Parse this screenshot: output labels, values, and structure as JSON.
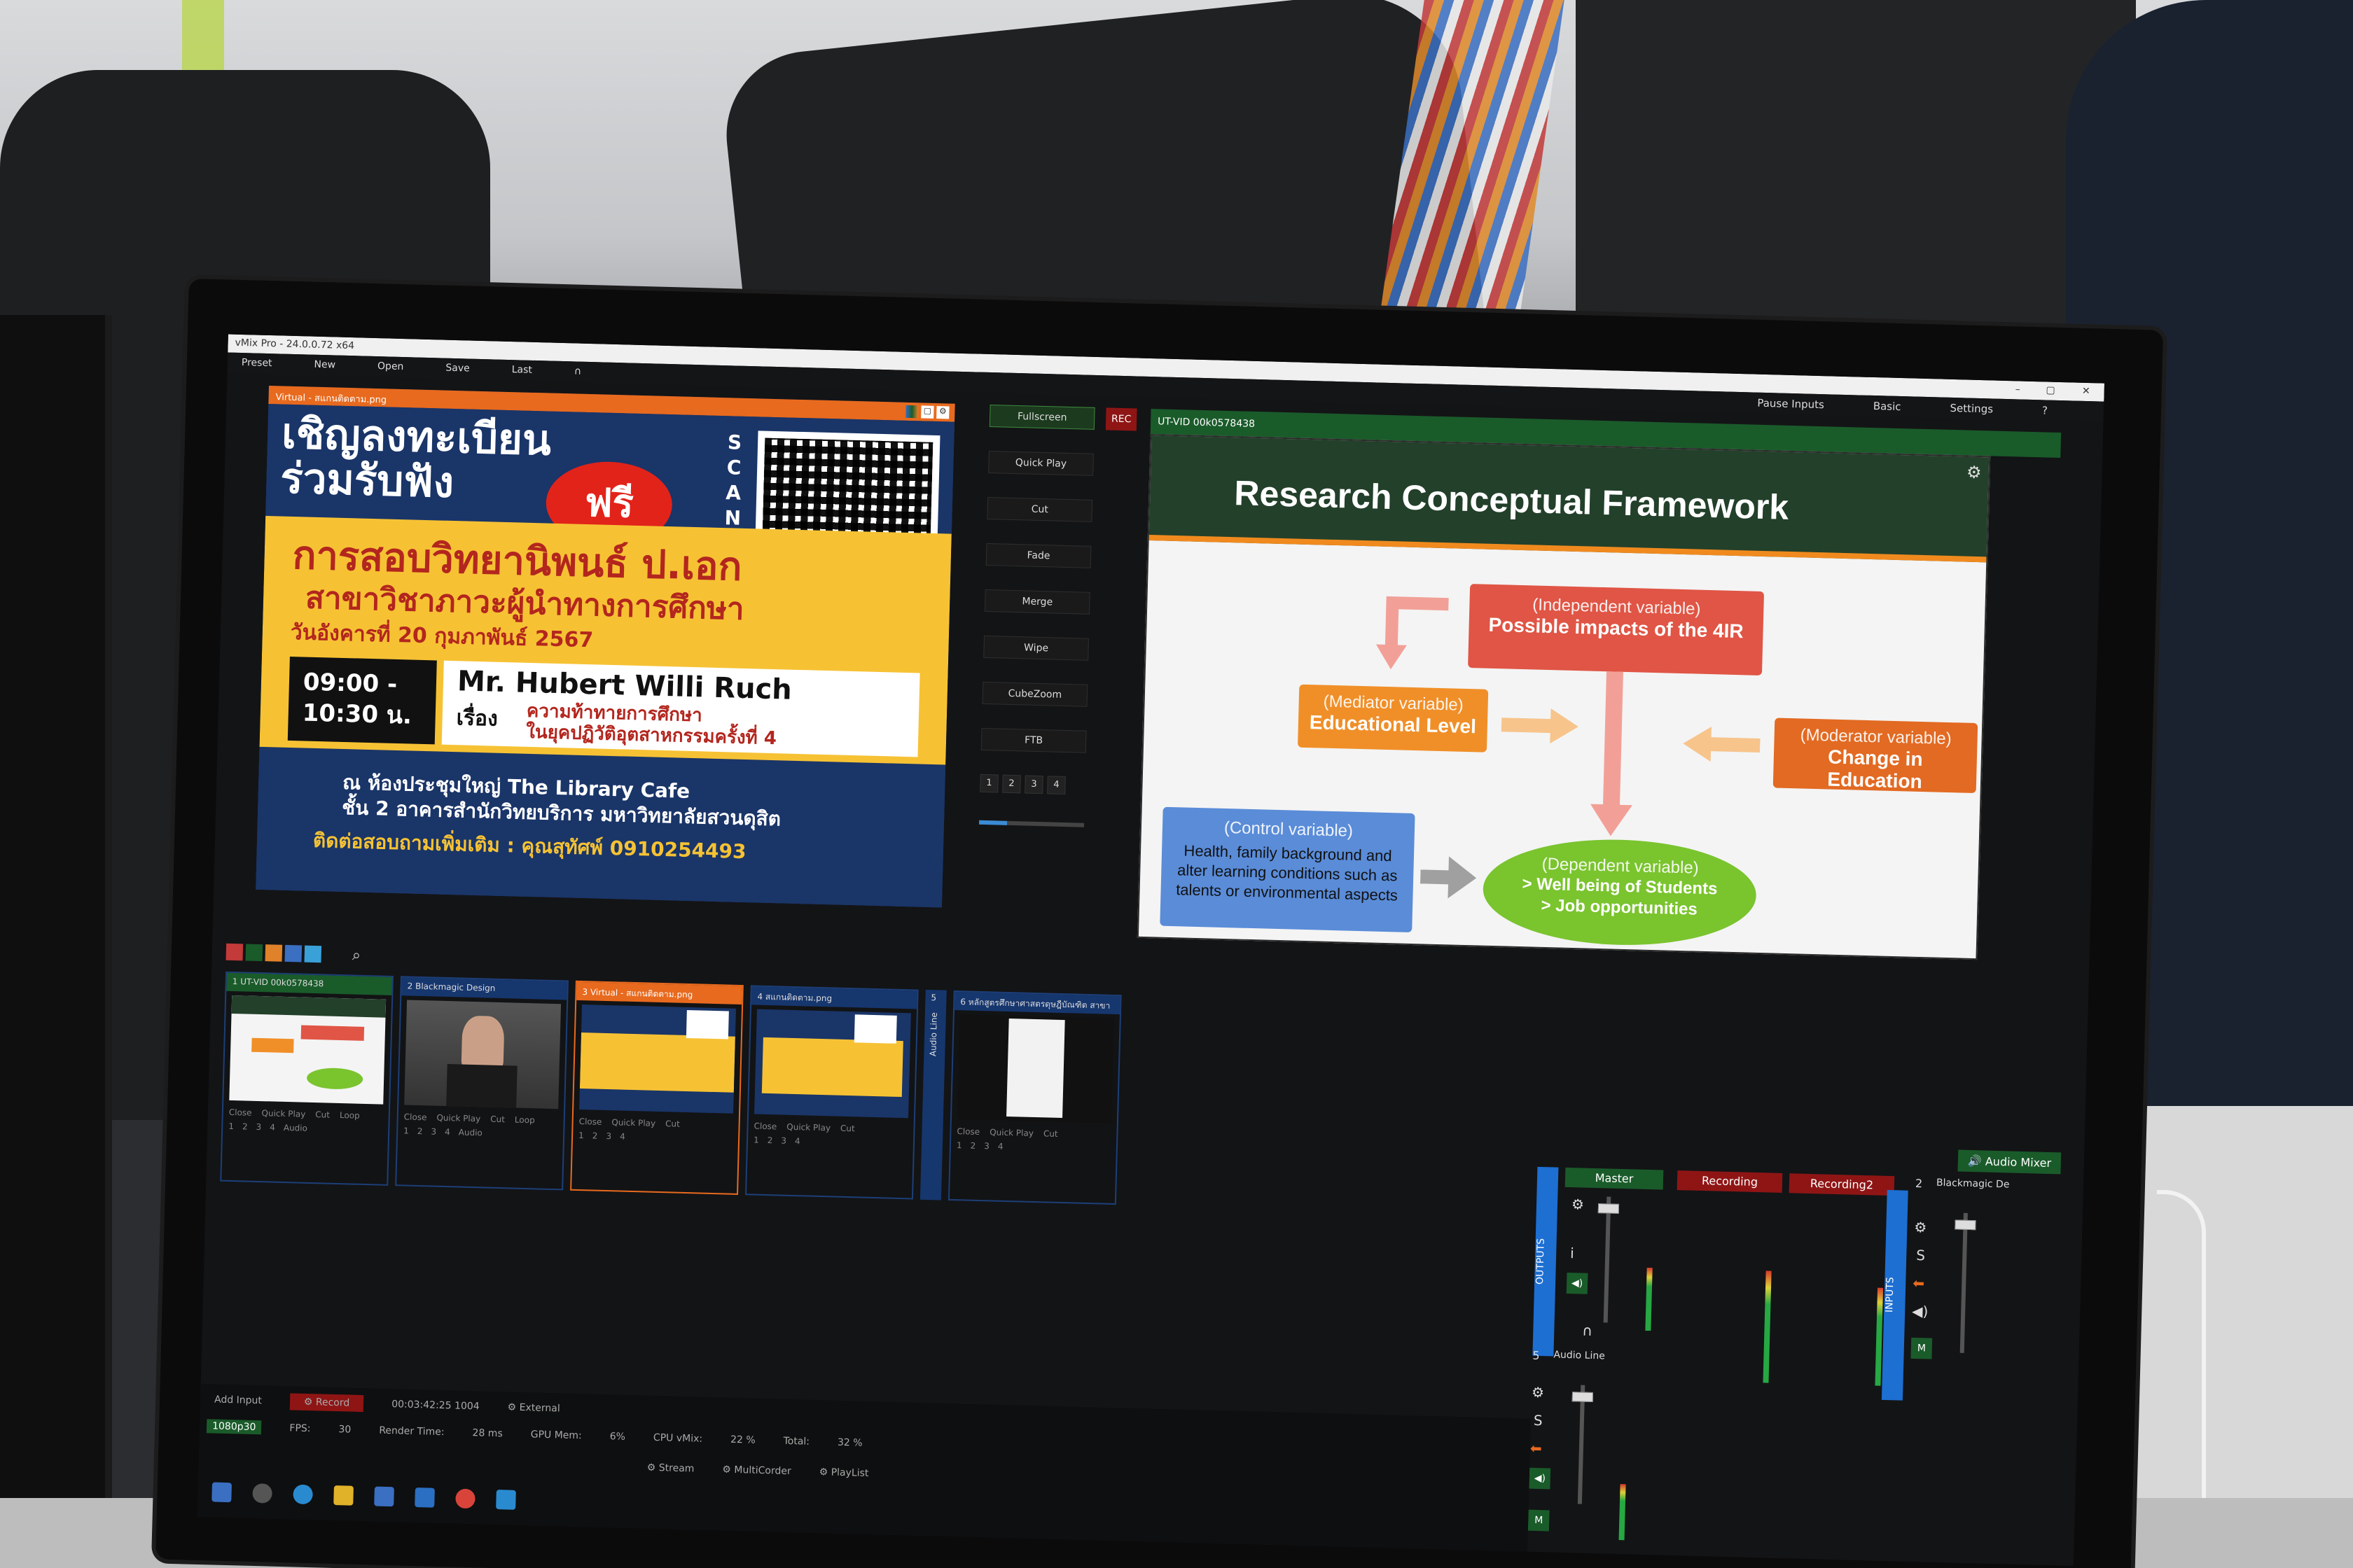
{
  "window": {
    "title": "vMix Pro - 24.0.0.72 x64",
    "menu": [
      "Preset",
      "New",
      "Open",
      "Save",
      "Last"
    ]
  },
  "preview": {
    "header": "Virtual - สแกนติดตาม.png",
    "poster": {
      "line1": "เชิญลงทะเบียน",
      "line2": "ร่วมรับฟัง",
      "free": "ฟรี",
      "scan": [
        "S",
        "C",
        "A",
        "N"
      ],
      "headline": "การสอบวิทยานิพนธ์ ป.เอก",
      "program": "สาขาวิชาภาวะผู้นำทางการศึกษา",
      "date": "วันอังคารที่ 20 กุมภาพันธ์ 2567",
      "time_start": "09:00 -",
      "time_end": "10:30 น.",
      "speaker": "Mr. Hubert Willi Ruch",
      "topic_label": "เรื่อง",
      "topic_line1": "ความท้าทายการศึกษา",
      "topic_line2": "ในยุคปฏิวัติอุตสาหกรรมครั้งที่ 4",
      "venue_line1": "ณ ห้องประชุมใหญ่ The Library Cafe",
      "venue_line2": "ชั้น 2 อาคารสำนักวิทยบริการ มหาวิทยาลัยสวนดุสิต",
      "contact": "ติดต่อสอบถามเพิ่มเติม : คุณสุทัศพ์  0910254493"
    }
  },
  "transitions": {
    "top": "Fullscreen",
    "rec": "REC",
    "buttons": [
      "Quick Play",
      "Cut",
      "Fade",
      "Merge",
      "Wipe",
      "CubeZoom",
      "FTB"
    ],
    "numbers": [
      "1",
      "2",
      "3",
      "4"
    ]
  },
  "output": {
    "header": "UT-VID 00k0578438",
    "menu": [
      "Pause Inputs",
      "Basic",
      "Settings",
      "?"
    ],
    "slide": {
      "title": "Research Conceptual Framework",
      "independent_label": "(Independent variable)",
      "independent_text": "Possible impacts of the 4IR",
      "mediator_label": "(Mediator variable)",
      "mediator_text": "Educational Level",
      "moderator_label": "(Moderator variable)",
      "moderator_text": "Change in Education",
      "control_label": "(Control variable)",
      "control_text": "Health, family background and alter learning conditions such as talents or environmental aspects",
      "dependent_label": "(Dependent variable)",
      "dependent_line1": "> Well being of Students",
      "dependent_line2": "> Job opportunities"
    }
  },
  "inputs": {
    "palette": [
      "#c23a3a",
      "#1a5b2a",
      "#e0822a",
      "#3a6fc2",
      "#3aa0d8"
    ],
    "tiles": [
      {
        "head": "1 UT-VID 00k0578438",
        "style": "green",
        "ctrls": [
          "Close",
          "Quick Play",
          "Cut",
          "Loop"
        ],
        "nums": [
          "1",
          "2",
          "3",
          "4"
        ],
        "extra": "Audio"
      },
      {
        "head": "2 Blackmagic Design",
        "style": "blue",
        "ctrls": [
          "Close",
          "Quick Play",
          "Cut",
          "Loop"
        ],
        "nums": [
          "1",
          "2",
          "3",
          "4"
        ],
        "extra": "Audio"
      },
      {
        "head": "3 Virtual - สแกนติดตาม.png",
        "style": "orange",
        "ctrls": [
          "Close",
          "Quick Play",
          "Cut"
        ],
        "nums": [
          "1",
          "2",
          "3",
          "4"
        ],
        "extra": ""
      },
      {
        "head": "4 สแกนติดตาม.png",
        "style": "blue",
        "ctrls": [
          "Close",
          "Quick Play",
          "Cut"
        ],
        "nums": [
          "1",
          "2",
          "3",
          "4"
        ],
        "extra": ""
      },
      {
        "head": "6 หลักสูตรศึกษาศาสตรดุษฎีบัณฑิต สาขา",
        "style": "blue",
        "ctrls": [
          "Close",
          "Quick Play",
          "Cut"
        ],
        "nums": [
          "1",
          "2",
          "3",
          "4"
        ],
        "extra": ""
      }
    ],
    "tile5_label": "5",
    "audio_line_label": "Audio Line"
  },
  "audio": {
    "mixer_label": "Audio Mixer",
    "outputs_label": "OUTPUTS",
    "inputs_label": "INPUTS",
    "master": "Master",
    "recording": "Recording",
    "recording2": "Recording2",
    "input2_num": "2",
    "input2_name": "Blackmagic De",
    "input5_num": "5",
    "input5_name": "Audio Line",
    "s_label": "S",
    "m_label": "M",
    "i_label": "i"
  },
  "status": {
    "add_input": "Add Input",
    "record": "Record",
    "timecode": "00:03:42:25 1004",
    "external": "External",
    "stream": "Stream",
    "multicorder": "MultiCorder",
    "playlist": "PlayList",
    "fps_label": "FPS:",
    "fps": "30",
    "render_label": "Render Time:",
    "render": "28 ms",
    "gpu_label": "GPU Mem:",
    "gpu": "6%",
    "cpu_label": "CPU vMix:",
    "cpu": "22 %",
    "total_label": "Total:",
    "total": "32 %",
    "res": "1080p30"
  }
}
